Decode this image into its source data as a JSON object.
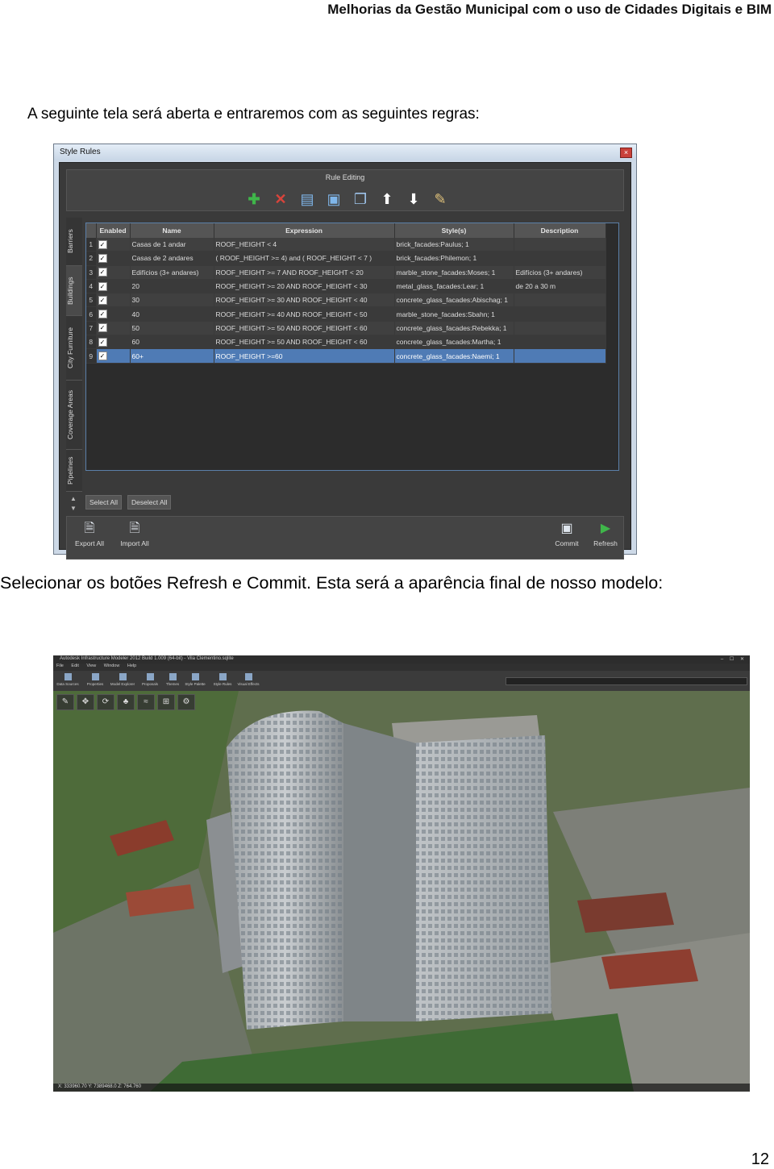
{
  "header": {
    "title": "Melhorias da Gestão Municipal com o uso de Cidades Digitais e BIM"
  },
  "intro_text": "A seguinte tela será aberta e entraremos com as seguintes regras:",
  "style_rules_dialog": {
    "window_title": "Style Rules",
    "close_label": "×",
    "rule_editing_title": "Rule Editing",
    "toolbar_icons": [
      "add-icon",
      "delete-icon",
      "copy-icon",
      "paste-icon",
      "duplicate-icon",
      "move-up-icon",
      "move-down-icon",
      "edit-icon"
    ],
    "side_tabs": [
      "Barriers",
      "Buildings",
      "City Furniture",
      "Coverage Areas",
      "Pipelines"
    ],
    "columns": [
      "Enabled",
      "Name",
      "Expression",
      "Style(s)",
      "Description"
    ],
    "rows": [
      {
        "num": "1",
        "name": "Casas de 1 andar",
        "expression": "ROOF_HEIGHT  < 4",
        "style": "brick_facades:Paulus; 1",
        "description": ""
      },
      {
        "num": "2",
        "name": "Casas de 2 andares",
        "expression": "( ROOF_HEIGHT  >= 4) and  ( ROOF_HEIGHT  < 7 )",
        "style": "brick_facades:Philemon; 1",
        "description": ""
      },
      {
        "num": "3",
        "name": "Edifícios (3+ andares)",
        "expression": "ROOF_HEIGHT  >= 7  AND  ROOF_HEIGHT  < 20",
        "style": "marble_stone_facades:Moses; 1",
        "description": "Edifícios (3+ andares)"
      },
      {
        "num": "4",
        "name": "20",
        "expression": "ROOF_HEIGHT  >= 20 AND  ROOF_HEIGHT  < 30",
        "style": "metal_glass_facades:Lear; 1",
        "description": "de 20 a 30 m"
      },
      {
        "num": "5",
        "name": "30",
        "expression": "ROOF_HEIGHT  >= 30 AND  ROOF_HEIGHT  < 40",
        "style": "concrete_glass_facades:Abischag; 1",
        "description": ""
      },
      {
        "num": "6",
        "name": "40",
        "expression": "ROOF_HEIGHT  >= 40 AND  ROOF_HEIGHT  < 50",
        "style": "marble_stone_facades:Sbahn; 1",
        "description": ""
      },
      {
        "num": "7",
        "name": "50",
        "expression": "ROOF_HEIGHT  >= 50 AND  ROOF_HEIGHT  < 60",
        "style": "concrete_glass_facades:Rebekka; 1",
        "description": ""
      },
      {
        "num": "8",
        "name": "60",
        "expression": "ROOF_HEIGHT  >= 50 AND  ROOF_HEIGHT  < 60",
        "style": "concrete_glass_facades:Martha; 1",
        "description": ""
      },
      {
        "num": "9",
        "name": "60+",
        "expression": "ROOF_HEIGHT  >=60",
        "style": "concrete_glass_facades:Naemi; 1",
        "description": ""
      }
    ],
    "select_all_label": "Select All",
    "deselect_all_label": "Deselect All",
    "export_all_label": "Export All",
    "import_all_label": "Import All",
    "commit_label": "Commit",
    "refresh_label": "Refresh"
  },
  "instruction_text": "Selecionar os botões Refresh e Commit. Esta será a aparência final de nosso modelo:",
  "model_window": {
    "title": "Autodesk Infrastructure Modeler 2012  Build 1.009 (64-bit) - Vila Clementino.sqlite",
    "menu": [
      "File",
      "Edit",
      "View",
      "Window",
      "Help"
    ],
    "ribbon": [
      "Data Sources",
      "Properties",
      "Model Explorer",
      "Proposals",
      "Themes",
      "Style Palette",
      "Style Rules",
      "Visual Effects"
    ],
    "status": "X: 333960.70  Y: 7389468.0  Z: 764.760"
  },
  "page_number": "12",
  "colors": {
    "dialog_bg": "#3a3a3a",
    "selection": "#4f7bb5",
    "add_green": "#3fb64a",
    "delete_red": "#d9443b"
  }
}
